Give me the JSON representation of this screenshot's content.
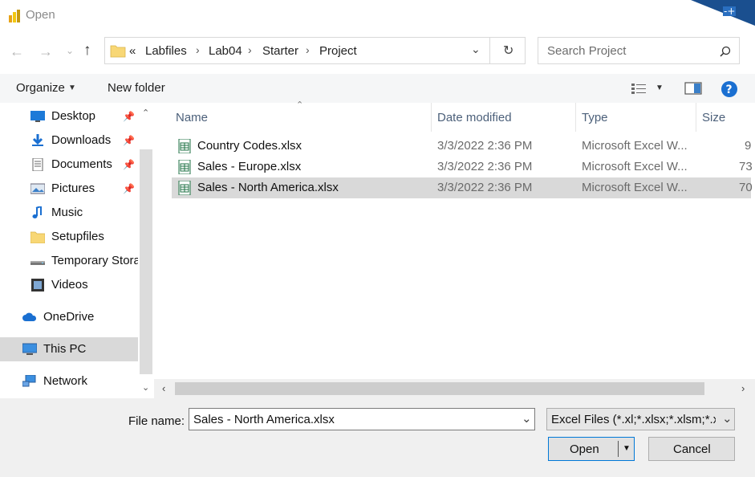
{
  "window": {
    "title": "Open"
  },
  "address": {
    "overflow": "«",
    "crumbs": [
      "Labfiles",
      "Lab04",
      "Starter",
      "Project"
    ],
    "separator": "›"
  },
  "search": {
    "placeholder": "Search Project"
  },
  "toolbar": {
    "organize_label": "Organize",
    "new_folder_label": "New folder"
  },
  "nav": {
    "items": [
      {
        "label": "Desktop",
        "icon": "desktop-icon",
        "pinned": true
      },
      {
        "label": "Downloads",
        "icon": "download-icon",
        "pinned": true
      },
      {
        "label": "Documents",
        "icon": "document-icon",
        "pinned": true
      },
      {
        "label": "Pictures",
        "icon": "pictures-icon",
        "pinned": true
      },
      {
        "label": "Music",
        "icon": "music-icon",
        "pinned": false
      },
      {
        "label": "Setupfiles",
        "icon": "folder-icon",
        "pinned": false
      },
      {
        "label": "Temporary Stora",
        "icon": "drive-icon",
        "pinned": false
      },
      {
        "label": "Videos",
        "icon": "video-icon",
        "pinned": false
      },
      {
        "label": "OneDrive",
        "icon": "cloud-icon",
        "pinned": false
      },
      {
        "label": "This PC",
        "icon": "computer-icon",
        "pinned": false
      },
      {
        "label": "Network",
        "icon": "network-icon",
        "pinned": false
      }
    ],
    "selected": "This PC"
  },
  "columns": {
    "name": "Name",
    "date": "Date modified",
    "type": "Type",
    "size": "Size"
  },
  "files": [
    {
      "name": "Country Codes.xlsx",
      "date": "3/3/2022 2:36 PM",
      "type": "Microsoft Excel W...",
      "size": "9"
    },
    {
      "name": "Sales - Europe.xlsx",
      "date": "3/3/2022 2:36 PM",
      "type": "Microsoft Excel W...",
      "size": "73"
    },
    {
      "name": "Sales - North America.xlsx",
      "date": "3/3/2022 2:36 PM",
      "type": "Microsoft Excel W...",
      "size": "70"
    }
  ],
  "selected_file": "Sales - North America.xlsx",
  "footer": {
    "filename_label": "File name:",
    "filename_value": "Sales - North America.xlsx",
    "filetype_value": "Excel Files (*.xl;*.xlsx;*.xlsm;*.xl",
    "open_label": "Open",
    "cancel_label": "Cancel"
  },
  "colors": {
    "accent": "#0078d7",
    "excel_green": "#1f7244",
    "folder_yellow": "#f8d775"
  }
}
